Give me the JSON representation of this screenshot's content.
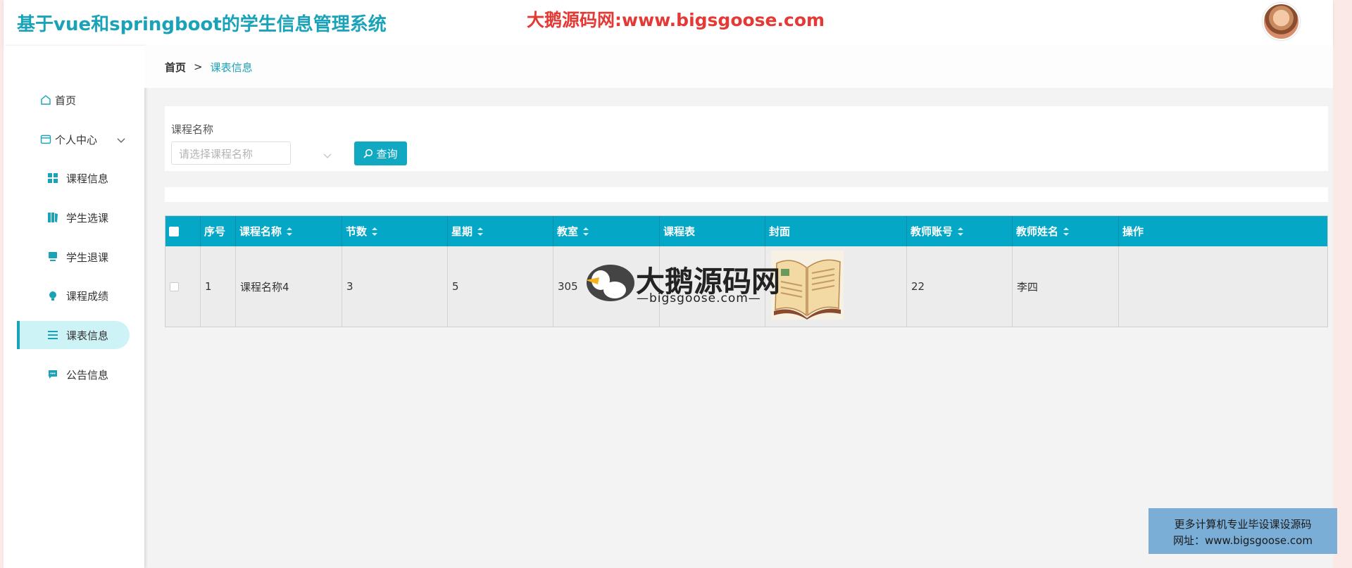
{
  "header": {
    "title": "基于vue和springboot的学生信息管理系统",
    "watermark": "大鹅源码网:www.bigsgoose.com"
  },
  "sidebar": {
    "items": [
      {
        "label": "首页",
        "icon": "home-icon"
      },
      {
        "label": "个人中心",
        "icon": "user-center-icon"
      },
      {
        "label": "课程信息",
        "icon": "grid-icon"
      },
      {
        "label": "学生选课",
        "icon": "book-icon"
      },
      {
        "label": "学生退课",
        "icon": "monitor-icon"
      },
      {
        "label": "课程成绩",
        "icon": "bulb-icon"
      },
      {
        "label": "课表信息",
        "icon": "list-icon"
      },
      {
        "label": "公告信息",
        "icon": "message-icon"
      }
    ],
    "active": "课表信息"
  },
  "breadcrumb": {
    "home": "首页",
    "separator": ">",
    "current": "课表信息"
  },
  "search": {
    "label": "课程名称",
    "placeholder": "请选择课程名称",
    "button": "查询"
  },
  "table": {
    "columns": [
      "序号",
      "课程名称",
      "节数",
      "星期",
      "教室",
      "课程表",
      "封面",
      "教师账号",
      "教师姓名",
      "操作"
    ],
    "rows": [
      {
        "index": "1",
        "course_name": "课程名称4",
        "sections": "3",
        "weekday": "5",
        "classroom": "305",
        "schedule": "",
        "teacher_account": "22",
        "teacher_name": "李四"
      }
    ]
  },
  "watermark_center": {
    "title": "大鹅源码网",
    "sub": "—bigsgoose.com—"
  },
  "promo": {
    "line1": "更多计算机专业毕设课设源码",
    "line2": "网址：www.bigsgoose.com"
  },
  "colors": {
    "accent": "#1aa3b8",
    "table_header": "#04a7c6",
    "watermark_red": "#e53935",
    "promo_bg": "#7aaed6"
  }
}
